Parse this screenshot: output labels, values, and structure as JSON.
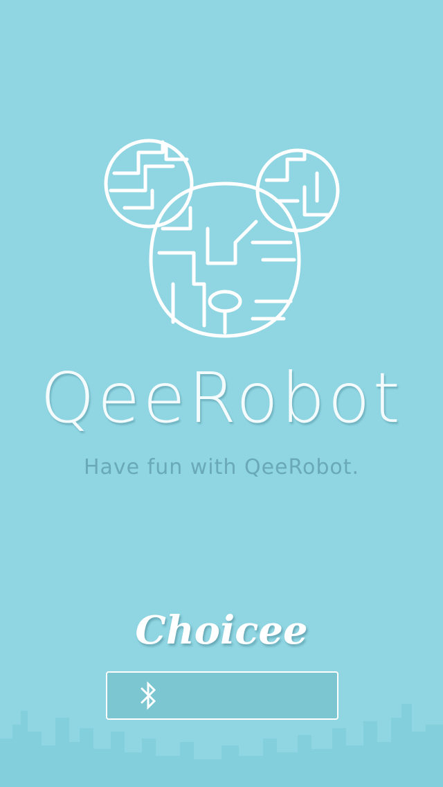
{
  "app": {
    "title": "QeeRobot",
    "tagline": "Have fun with QeeRobot."
  },
  "brand": {
    "name": "Choicee"
  },
  "connect_button": {
    "icon": "bluetooth-icon"
  },
  "colors": {
    "background": "#8fd5e2",
    "title": "#f4fbfd",
    "tagline": "#6aa9b7",
    "button_border": "#ffffff"
  }
}
